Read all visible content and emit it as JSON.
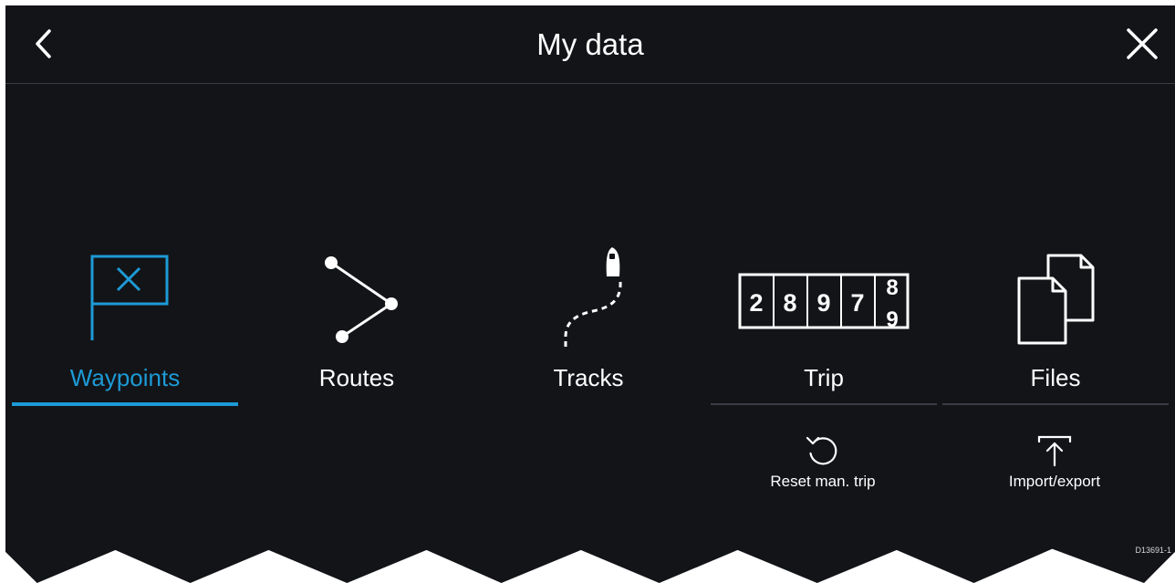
{
  "header": {
    "title": "My data"
  },
  "tiles": [
    {
      "label": "Waypoints",
      "icon": "waypoint-flag-icon",
      "active": true
    },
    {
      "label": "Routes",
      "icon": "route-icon",
      "active": false
    },
    {
      "label": "Tracks",
      "icon": "track-boat-icon",
      "active": false
    },
    {
      "label": "Trip",
      "icon": "trip-odometer-icon",
      "active": false
    },
    {
      "label": "Files",
      "icon": "files-icon",
      "active": false
    }
  ],
  "odometer": {
    "digits": [
      "2",
      "8",
      "9",
      "7"
    ],
    "roll_top": "8",
    "roll_bottom": "9"
  },
  "actions": {
    "reset": {
      "label": "Reset man. trip",
      "icon": "reset-icon"
    },
    "import_export": {
      "label": "Import/export",
      "icon": "upload-icon"
    }
  },
  "reference": "D13691-1",
  "colors": {
    "background": "#121418",
    "accent": "#1d9ad6",
    "divider": "#3a3d44",
    "text": "#ffffff"
  }
}
